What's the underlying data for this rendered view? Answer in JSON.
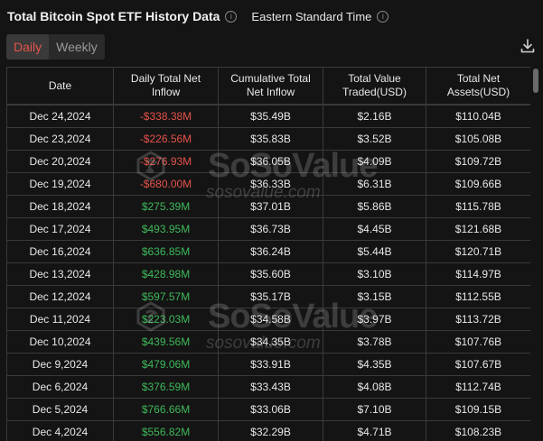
{
  "header": {
    "title": "Total Bitcoin Spot ETF History Data",
    "timezone": "Eastern Standard Time"
  },
  "tabs": [
    {
      "label": "Daily",
      "active": true
    },
    {
      "label": "Weekly",
      "active": false
    }
  ],
  "icons": {
    "info": "info-icon",
    "download": "download-icon"
  },
  "colors": {
    "negative": "#e5534b",
    "positive": "#3fb95a",
    "background": "#141414"
  },
  "table": {
    "columns": [
      "Date",
      "Daily Total Net Inflow",
      "Cumulative Total Net Inflow",
      "Total Value Traded(USD)",
      "Total Net Assets(USD)"
    ],
    "rows": [
      [
        "Dec 24,2024",
        "-$338.38M",
        "$35.49B",
        "$2.16B",
        "$110.04B"
      ],
      [
        "Dec 23,2024",
        "-$226.56M",
        "$35.83B",
        "$3.52B",
        "$105.08B"
      ],
      [
        "Dec 20,2024",
        "-$276.93M",
        "$36.05B",
        "$4.09B",
        "$109.72B"
      ],
      [
        "Dec 19,2024",
        "-$680.00M",
        "$36.33B",
        "$6.31B",
        "$109.66B"
      ],
      [
        "Dec 18,2024",
        "$275.39M",
        "$37.01B",
        "$5.86B",
        "$115.78B"
      ],
      [
        "Dec 17,2024",
        "$493.95M",
        "$36.73B",
        "$4.45B",
        "$121.68B"
      ],
      [
        "Dec 16,2024",
        "$636.85M",
        "$36.24B",
        "$5.44B",
        "$120.71B"
      ],
      [
        "Dec 13,2024",
        "$428.98M",
        "$35.60B",
        "$3.10B",
        "$114.97B"
      ],
      [
        "Dec 12,2024",
        "$597.57M",
        "$35.17B",
        "$3.15B",
        "$112.55B"
      ],
      [
        "Dec 11,2024",
        "$223.03M",
        "$34.58B",
        "$3.97B",
        "$113.72B"
      ],
      [
        "Dec 10,2024",
        "$439.56M",
        "$34.35B",
        "$3.78B",
        "$107.76B"
      ],
      [
        "Dec 9,2024",
        "$479.06M",
        "$33.91B",
        "$4.35B",
        "$107.67B"
      ],
      [
        "Dec 6,2024",
        "$376.59M",
        "$33.43B",
        "$4.08B",
        "$112.74B"
      ],
      [
        "Dec 5,2024",
        "$766.66M",
        "$33.06B",
        "$7.10B",
        "$109.15B"
      ],
      [
        "Dec 4,2024",
        "$556.82M",
        "$32.29B",
        "$4.71B",
        "$108.23B"
      ]
    ]
  },
  "watermark": {
    "logo": "SoSoValue",
    "url": "sosovalue.com"
  }
}
